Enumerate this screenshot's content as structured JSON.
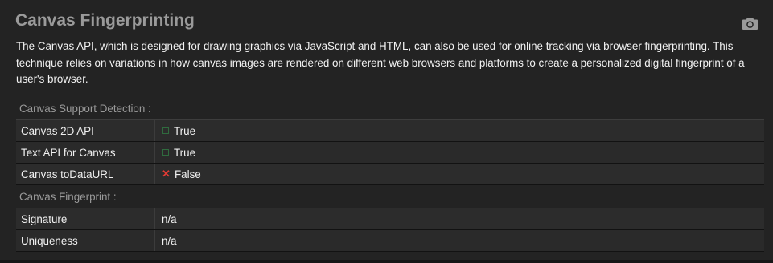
{
  "header": {
    "title": "Canvas Fingerprinting",
    "camera_icon": "camera-icon"
  },
  "description": "The Canvas API, which is designed for drawing graphics via JavaScript and HTML, can also be used for online tracking via browser fingerprinting. This technique relies on variations in how canvas images are rendered on different web browsers and platforms to create a personalized digital fingerprint of a user's browser.",
  "support": {
    "label": "Canvas Support Detection :",
    "rows": [
      {
        "label": "Canvas 2D API",
        "value": "True",
        "status_icon": "check-icon",
        "status_color": "#2f6b3e"
      },
      {
        "label": "Text API for Canvas",
        "value": "True",
        "status_icon": "check-icon",
        "status_color": "#2f6b3e"
      },
      {
        "label": "Canvas toDataURL",
        "value": "False",
        "status_icon": "x-icon",
        "status_color": "#e03a34"
      }
    ]
  },
  "fingerprint": {
    "label": "Canvas Fingerprint :",
    "rows": [
      {
        "label": "Signature",
        "value": "n/a"
      },
      {
        "label": "Uniqueness",
        "value": "n/a"
      }
    ]
  }
}
